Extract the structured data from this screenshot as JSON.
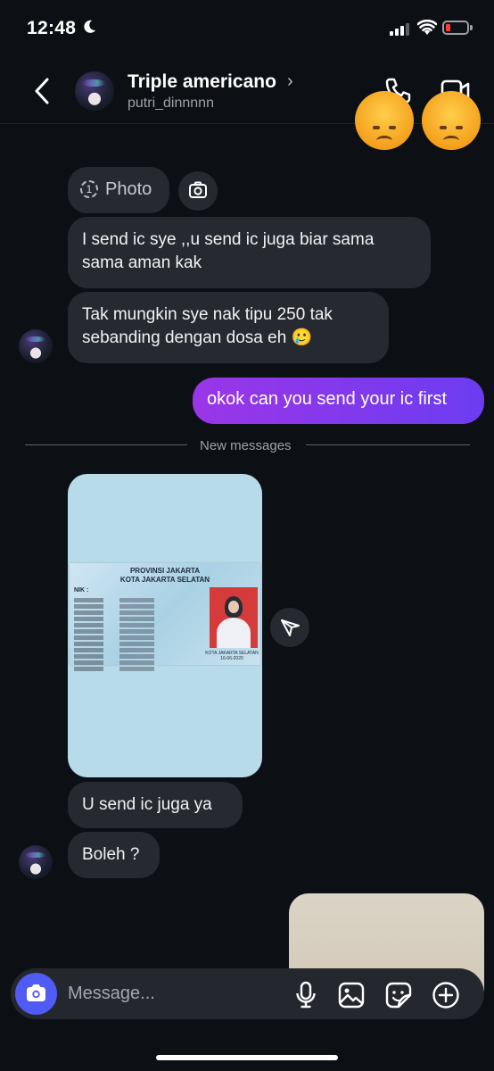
{
  "status_bar": {
    "time": "12:48",
    "battery_color": "#ff3b30"
  },
  "header": {
    "name": "Triple americano",
    "chevron": "›",
    "username": "putri_dinnnnn"
  },
  "messages": {
    "photo_label": "Photo",
    "photo_count": "1",
    "m1": "I send ic sye ,,u send ic juga biar sama sama aman kak",
    "m2": "Tak mungkin sye nak tipu 250 tak sebanding dengan dosa eh 🥲",
    "me1": "okok can you send your ic first",
    "divider": "New messages",
    "m3": "U send ic juga ya",
    "m4": "Boleh ?"
  },
  "id_card": {
    "province": "PROVINSI JAKARTA",
    "city": "KOTA JAKARTA SELATAN",
    "nik_label": "NIK :",
    "caption": "KOTA JAKARTA SELATAN",
    "date": "16-06-2020"
  },
  "composer": {
    "placeholder": "Message..."
  },
  "accent": {
    "outgoing_start": "#9a36e8",
    "outgoing_end": "#6c3cf0",
    "camera_button": "#4f5bf2"
  }
}
